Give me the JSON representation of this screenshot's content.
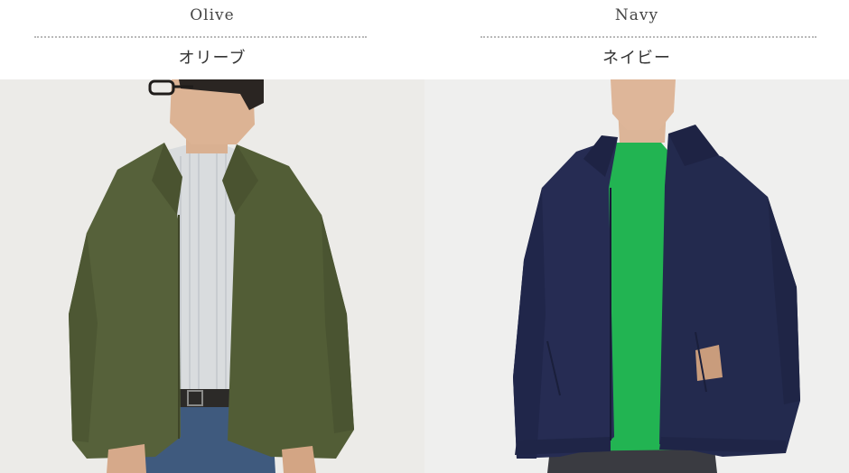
{
  "colors": [
    {
      "name_en": "Olive",
      "name_jp": "オリーブ",
      "jacket_color": "#56613a",
      "background_color": "#ecebe9"
    },
    {
      "name_en": "Navy",
      "name_jp": "ネイビー",
      "jacket_color": "#242a4e",
      "background_color": "#efefef"
    }
  ]
}
